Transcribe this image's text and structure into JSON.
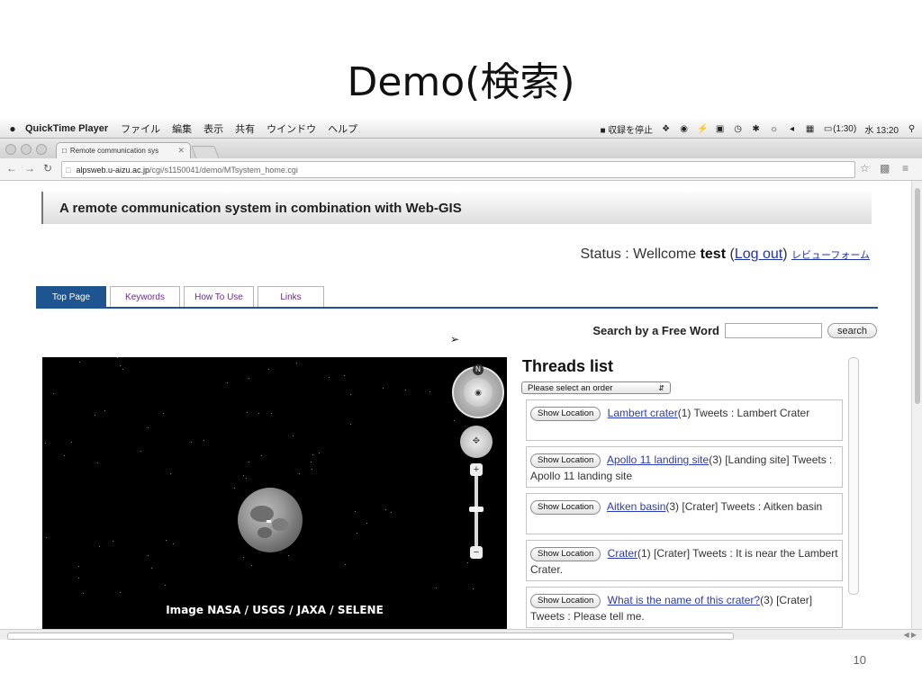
{
  "slide": {
    "title": "Demo(検索)",
    "page_number": "10"
  },
  "menubar": {
    "app_name": "QuickTime Player",
    "items": [
      "ファイル",
      "編集",
      "表示",
      "共有",
      "ウインドウ",
      "ヘルプ"
    ],
    "record_label": "収録を停止",
    "battery": "(1:30)",
    "clock": "水 13:20"
  },
  "browser": {
    "tab_title": "Remote communication sys",
    "url_host": "alpsweb.u-aizu.ac.jp",
    "url_path": "/cgi/s1150041/demo/MTsystem_home.cgi"
  },
  "site": {
    "title": "A remote communication system in combination with Web-GIS",
    "status_prefix": "Status : Wellcome",
    "user": "test",
    "logout": "Log out",
    "review_form": "レビューフォーム",
    "tabs": [
      "Top Page",
      "Keywords",
      "How To Use",
      "Links"
    ],
    "search_label": "Search by a Free Word",
    "search_value": "",
    "search_button": "search"
  },
  "map": {
    "attribution": "Image NASA / USGS / JAXA / SELENE",
    "compass_north": "N"
  },
  "threads": {
    "title": "Threads list",
    "order_placeholder": "Please select an order",
    "show_button": "Show Location",
    "items": [
      {
        "link": "Lambert crater",
        "rest": "(1) Tweets : Lambert Crater"
      },
      {
        "link": "Apollo 11 landing site",
        "rest": "(3) [Landing site] Tweets : Apollo 11 landing site"
      },
      {
        "link": "Aitken basin",
        "rest": "(3) [Crater] Tweets : Aitken basin"
      },
      {
        "link": "Crater",
        "rest": "(1) [Crater] Tweets : It is near the Lambert Crater."
      },
      {
        "link": "What is the name of this crater?",
        "rest": "(3) [Crater] Tweets : Please tell me."
      }
    ]
  },
  "colors": {
    "tab_active": "#1e5590",
    "link": "#2a3ab8",
    "map_bg": "#000000"
  }
}
